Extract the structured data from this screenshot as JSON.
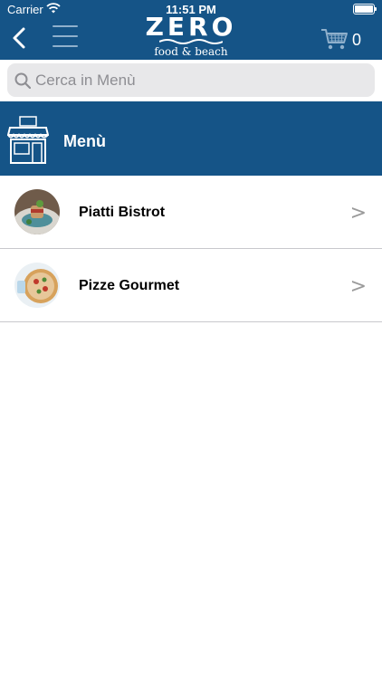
{
  "status_bar": {
    "carrier": "Carrier",
    "time": "11:51 PM"
  },
  "nav": {
    "logo_word": "ZERO",
    "logo_sub": "food & beach",
    "cart_count": "0"
  },
  "search": {
    "placeholder": "Cerca in Menù"
  },
  "section": {
    "title": "Menù"
  },
  "items": [
    {
      "label": "Piatti Bistrot",
      "chevron": ">"
    },
    {
      "label": "Pizze Gourmet",
      "chevron": ">"
    }
  ],
  "colors": {
    "primary": "#155487",
    "divider": "#c8c8cc",
    "search_bg": "#e8e8ea"
  }
}
